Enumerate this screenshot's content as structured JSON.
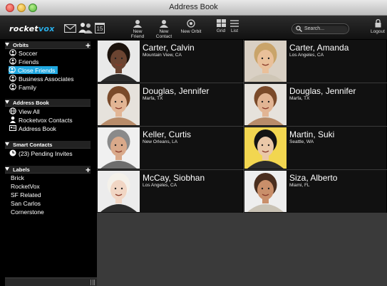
{
  "window": {
    "title": "Address Book"
  },
  "toolbar": {
    "logo_left": "rocket",
    "logo_right": "vox",
    "buttons": [
      {
        "label": "New Friend",
        "icon": "new-friend-icon"
      },
      {
        "label": "New Contact",
        "icon": "new-contact-icon"
      },
      {
        "label": "New Orbit",
        "icon": "new-orbit-icon"
      },
      {
        "label": "Grid",
        "icon": "grid-view-icon"
      },
      {
        "label": "List",
        "icon": "list-view-icon"
      }
    ],
    "search_placeholder": "Search...",
    "logout_label": "Logout",
    "calendar_day": "15"
  },
  "sidebar": {
    "orbits": {
      "title": "Orbits",
      "items": [
        {
          "label": "Soccer"
        },
        {
          "label": "Friends"
        },
        {
          "label": "Close Friends",
          "selected": true
        },
        {
          "label": "Business Associates"
        },
        {
          "label": "Family"
        }
      ]
    },
    "address_book": {
      "title": "Address Book",
      "items": [
        {
          "label": "View All",
          "icon": "globe-icon"
        },
        {
          "label": "Rocketvox Contacts",
          "icon": "person-icon"
        },
        {
          "label": "Address Book",
          "icon": "address-card-icon"
        }
      ]
    },
    "smart_contacts": {
      "title": "Smart Contacts",
      "items": [
        {
          "label": "(23) Pending Invites",
          "icon": "clock-icon"
        }
      ]
    },
    "labels": {
      "title": "Labels",
      "items": [
        {
          "label": "Brick"
        },
        {
          "label": "RocketVox"
        },
        {
          "label": "SF Related"
        },
        {
          "label": "San Carlos"
        },
        {
          "label": "Cornerstone"
        }
      ]
    }
  },
  "contacts": [
    {
      "name": "Carter, Calvin",
      "location": "Mountain View, CA",
      "skin": "#6b4431",
      "hair": "#1b120c",
      "bg": "#e9e9e9",
      "shirt": "#2a2a2a"
    },
    {
      "name": "Carter, Amanda",
      "location": "Los Angeles, CA",
      "skin": "#e9c09a",
      "hair": "#c9a46a",
      "bg": "#d9d0c4",
      "shirt": "#cfc6b6"
    },
    {
      "name": "Douglas, Jennifer",
      "location": "Marfa, TX",
      "skin": "#e2b594",
      "hair": "#7a4a2a",
      "bg": "#e6e2dc",
      "shirt": "#b88c6a"
    },
    {
      "name": "Douglas, Jennifer",
      "location": "Marfa, TX",
      "skin": "#e2b594",
      "hair": "#7a4a2a",
      "bg": "#e6e2dc",
      "shirt": "#b88c6a"
    },
    {
      "name": "Keller, Curtis",
      "location": "New Orleans, LA",
      "skin": "#d9a98a",
      "hair": "#8a8a8a",
      "bg": "#f0f0f0",
      "shirt": "#6d6d6d"
    },
    {
      "name": "Martin, Suki",
      "location": "Seattle, WA",
      "skin": "#eac8a8",
      "hair": "#141414",
      "bg": "#f2d650",
      "shirt": "#2b2b2b"
    },
    {
      "name": "McCay, Siobhan",
      "location": "Los Angeles, CA",
      "skin": "#f1d6c4",
      "hair": "#f4f1ea",
      "bg": "#ececec",
      "shirt": "#2d2d2d"
    },
    {
      "name": "Siza, Alberto",
      "location": "Miami, FL",
      "skin": "#c98f6a",
      "hair": "#4a2e1e",
      "bg": "#eeeeee",
      "shirt": "#c9c2b4"
    }
  ]
}
